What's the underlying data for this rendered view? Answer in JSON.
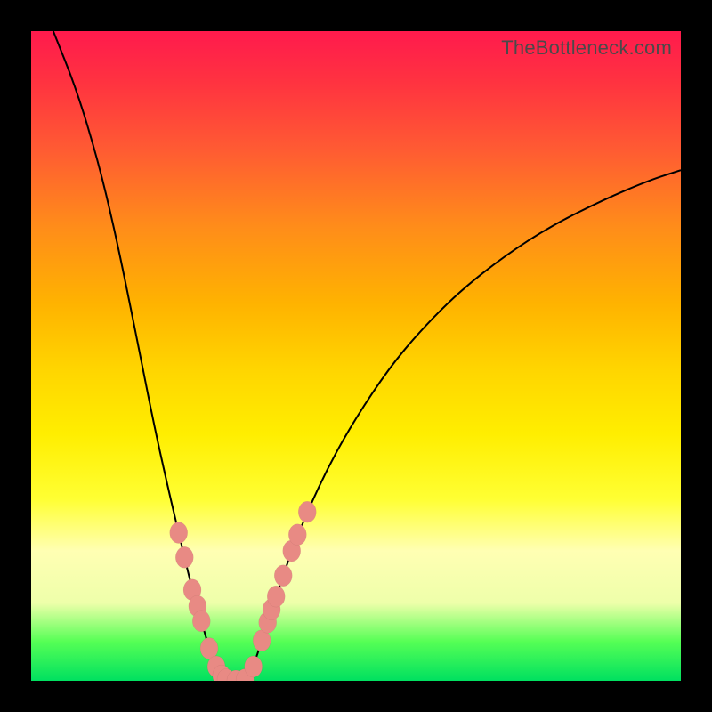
{
  "watermark": "TheBottleneck.com",
  "colors": {
    "bg": "#000000",
    "gradient_top": "#ff1a4d",
    "gradient_mid": "#ffee00",
    "gradient_bottom": "#00e060",
    "curve": "#000000",
    "marker": "#e88a84"
  },
  "chart_data": {
    "type": "line",
    "title": "",
    "xlabel": "",
    "ylabel": "",
    "xlim": [
      0,
      100
    ],
    "ylim": [
      0,
      100
    ],
    "grid": false,
    "left_curve": {
      "name": "bottleneck-left",
      "points": [
        {
          "x": 3.4,
          "y": 100.0
        },
        {
          "x": 7.0,
          "y": 91.0
        },
        {
          "x": 10.3,
          "y": 80.0
        },
        {
          "x": 12.7,
          "y": 70.0
        },
        {
          "x": 14.8,
          "y": 60.0
        },
        {
          "x": 17.0,
          "y": 49.0
        },
        {
          "x": 19.0,
          "y": 39.0
        },
        {
          "x": 21.0,
          "y": 30.0
        },
        {
          "x": 22.7,
          "y": 22.8
        },
        {
          "x": 24.8,
          "y": 14.0
        },
        {
          "x": 26.2,
          "y": 9.2
        },
        {
          "x": 27.4,
          "y": 5.0
        },
        {
          "x": 28.5,
          "y": 2.2
        },
        {
          "x": 30.0,
          "y": 0.2
        }
      ]
    },
    "right_curve": {
      "name": "bottleneck-right",
      "points": [
        {
          "x": 32.9,
          "y": 0.2
        },
        {
          "x": 34.2,
          "y": 2.2
        },
        {
          "x": 35.5,
          "y": 6.2
        },
        {
          "x": 36.4,
          "y": 9.0
        },
        {
          "x": 37.7,
          "y": 13.0
        },
        {
          "x": 38.8,
          "y": 16.2
        },
        {
          "x": 40.1,
          "y": 20.0
        },
        {
          "x": 42.5,
          "y": 26.0
        },
        {
          "x": 46.0,
          "y": 33.5
        },
        {
          "x": 50.0,
          "y": 40.5
        },
        {
          "x": 55.0,
          "y": 48.0
        },
        {
          "x": 60.0,
          "y": 54.0
        },
        {
          "x": 66.0,
          "y": 60.0
        },
        {
          "x": 73.0,
          "y": 65.5
        },
        {
          "x": 80.0,
          "y": 70.0
        },
        {
          "x": 88.0,
          "y": 74.0
        },
        {
          "x": 95.0,
          "y": 77.0
        },
        {
          "x": 100.0,
          "y": 78.6
        }
      ]
    },
    "markers": [
      {
        "x": 22.7,
        "y": 22.8
      },
      {
        "x": 23.6,
        "y": 19.0
      },
      {
        "x": 24.8,
        "y": 14.0
      },
      {
        "x": 25.6,
        "y": 11.5
      },
      {
        "x": 26.2,
        "y": 9.2
      },
      {
        "x": 27.4,
        "y": 5.0
      },
      {
        "x": 28.5,
        "y": 2.2
      },
      {
        "x": 29.3,
        "y": 0.8
      },
      {
        "x": 30.0,
        "y": 0.2
      },
      {
        "x": 31.5,
        "y": 0.0
      },
      {
        "x": 32.9,
        "y": 0.2
      },
      {
        "x": 34.2,
        "y": 2.2
      },
      {
        "x": 35.5,
        "y": 6.2
      },
      {
        "x": 36.4,
        "y": 9.0
      },
      {
        "x": 37.0,
        "y": 11.0
      },
      {
        "x": 37.7,
        "y": 13.0
      },
      {
        "x": 38.8,
        "y": 16.2
      },
      {
        "x": 40.1,
        "y": 20.0
      },
      {
        "x": 41.0,
        "y": 22.5
      },
      {
        "x": 42.5,
        "y": 26.0
      }
    ]
  }
}
